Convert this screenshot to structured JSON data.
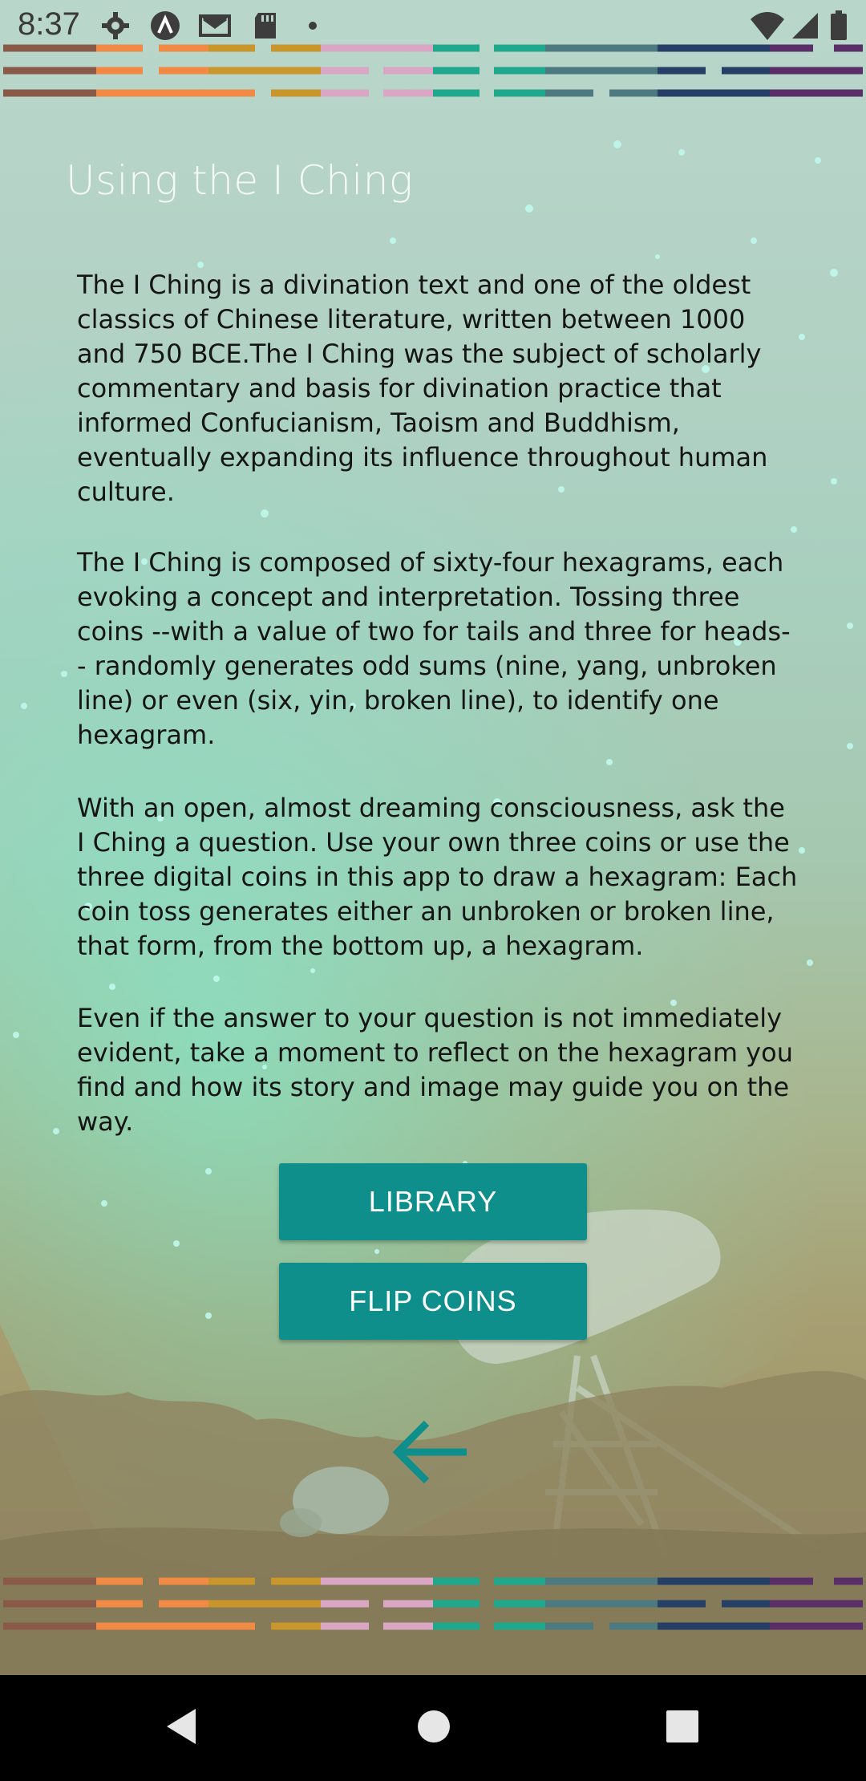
{
  "status_bar": {
    "time": "8:37",
    "icons": [
      "gear-icon",
      "a-circle-icon",
      "gmail-icon",
      "sd-card-icon",
      "dot-icon",
      "wifi-icon",
      "cell-signal-icon",
      "battery-icon"
    ]
  },
  "page": {
    "title": "Using the I Ching",
    "paragraphs": [
      "The I Ching is a divination text and one of the oldest classics of Chinese literature, written between 1000 and 750 BCE.The I Ching was the subject of scholarly commentary and basis for divination practice that informed Confucianism, Taoism and Buddhism, eventually expanding its influence throughout human culture.",
      "The I Ching is composed of sixty-four hexagrams, each evoking a concept and interpretation. Tossing three coins --with a value of two for tails and three for heads-- randomly generates odd sums (nine, yang, unbroken line) or even (six, yin, broken line), to identify one hexagram.",
      "With an open, almost dreaming consciousness, ask the I Ching a question. Use your own three coins or use the three digital coins in this app to draw a hexagram: Each coin toss generates either an unbroken or broken line, that form, from the bottom up, a hexagram.",
      "Even if the answer to your question is not immediately evident, take a moment to reflect on the hexagram you find and how its story and image may guide you on the way."
    ]
  },
  "buttons": {
    "library": "LIBRARY",
    "flip_coins": "FLIP COINS"
  },
  "colors": {
    "button_bg": "#0f8f8c",
    "arrow": "#0f8f8c",
    "title": "#f6faf6",
    "stripe_palette": [
      "#8a5a48",
      "#f08a44",
      "#c8962a",
      "#d9a6c4",
      "#1fa88c",
      "#4c7a80",
      "#263f66",
      "#5a2e66"
    ]
  },
  "nav_bar": {
    "icons": [
      "back-triangle-icon",
      "home-circle-icon",
      "recents-square-icon"
    ]
  }
}
